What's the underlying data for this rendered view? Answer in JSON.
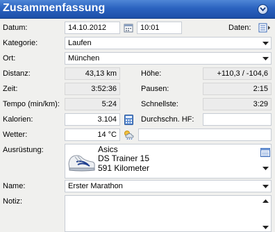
{
  "header": {
    "title": "Zusammenfassung"
  },
  "labels": {
    "datum": "Datum:",
    "daten": "Daten:",
    "kategorie": "Kategorie:",
    "ort": "Ort:",
    "distanz": "Distanz:",
    "hoehe": "Höhe:",
    "zeit": "Zeit:",
    "pausen": "Pausen:",
    "tempo": "Tempo (min/km):",
    "schnellste": "Schnellste:",
    "kalorien": "Kalorien:",
    "durchschn_hf": "Durchschn. HF:",
    "wetter": "Wetter:",
    "ausruestung": "Ausrüstung:",
    "name": "Name:",
    "notiz": "Notiz:"
  },
  "values": {
    "date": "14.10.2012",
    "time": "10:01",
    "kategorie": "Laufen",
    "ort": "München",
    "distanz": "43,13 km",
    "hoehe": "+110,3 / -104,6",
    "zeit": "3:52:36",
    "pausen": "2:15",
    "tempo": "5:24",
    "schnellste": "3:29",
    "kalorien": "3.104",
    "durchschn_hf": "",
    "wetter": "14 °C",
    "wetter_extra": "",
    "name": "Erster Marathon",
    "notiz": ""
  },
  "equipment": {
    "brand": "Asics",
    "model": "DS Trainer 15",
    "distance": "591 Kilometer"
  },
  "icons": {
    "header_button": "collapse-chevron-icon",
    "calendar": "calendar-icon",
    "data_menu": "data-menu-icon",
    "dropdown": "chevron-down-icon",
    "calculator": "calculator-icon",
    "weather": "weather-icon",
    "list": "list-icon",
    "shoe": "shoe-image"
  },
  "colors": {
    "header_top": "#4f86d6",
    "header_bottom": "#1c4fa8",
    "panel_bg": "#f0f0ee",
    "readonly_bg": "#ececec"
  }
}
